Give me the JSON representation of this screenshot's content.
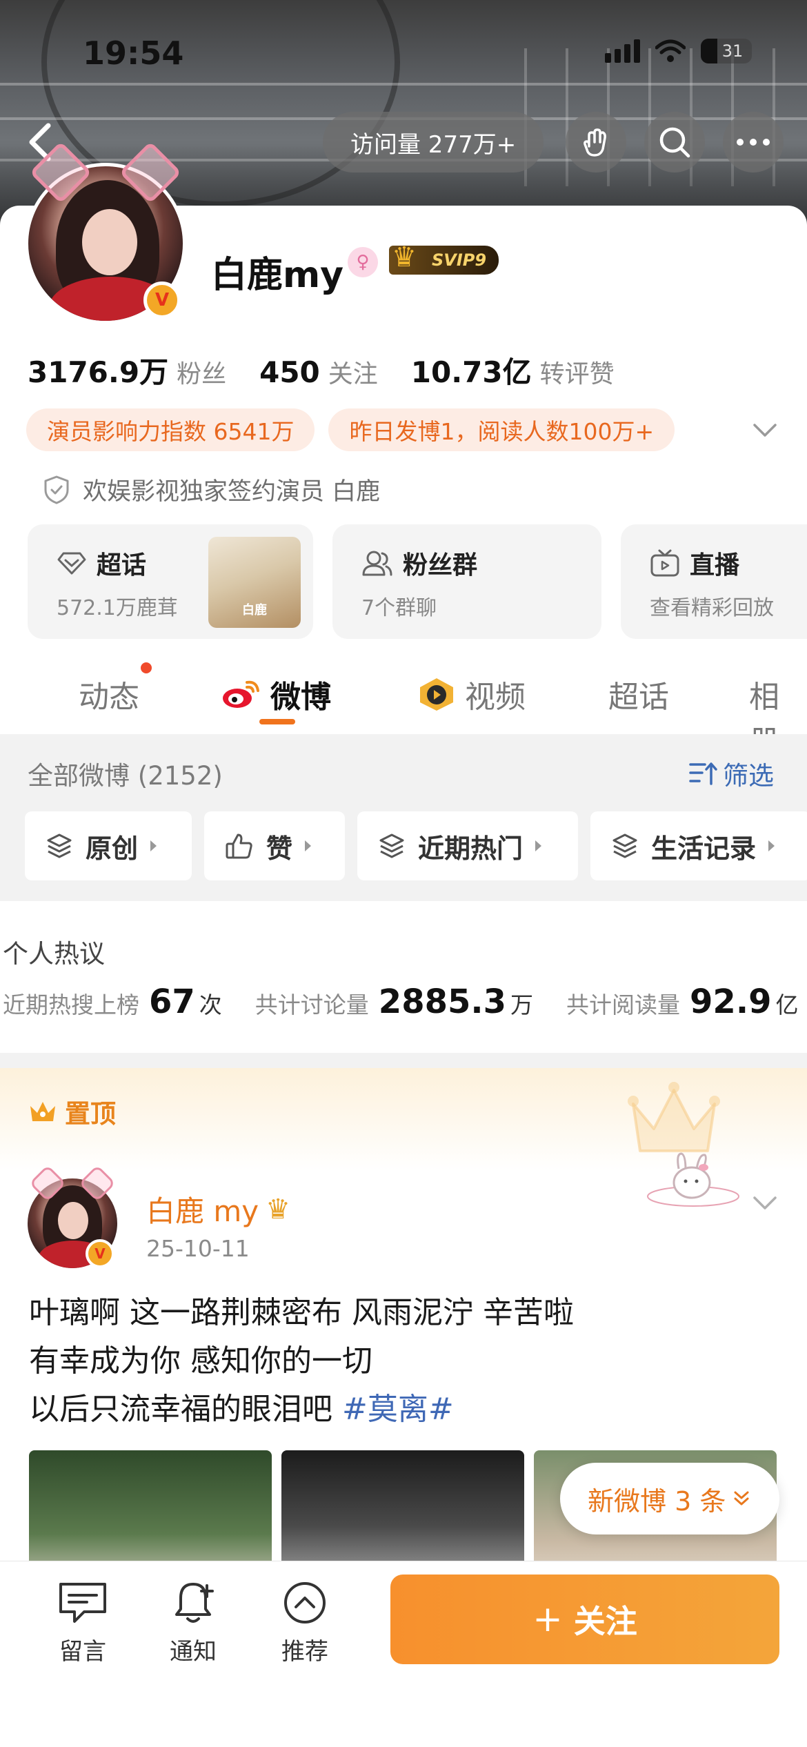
{
  "status_bar": {
    "time": "19:54",
    "battery": "31"
  },
  "header": {
    "visits": "访问量 277万+"
  },
  "profile": {
    "name": "白鹿my",
    "gender_symbol": "♀",
    "vip_badge": "SVIP9",
    "verified_mark": "V",
    "stats": [
      {
        "value": "3176.9万",
        "label": "粉丝"
      },
      {
        "value": "450",
        "label": "关注"
      },
      {
        "value": "10.73亿",
        "label": "转评赞"
      }
    ],
    "tags": [
      "演员影响力指数 6541万",
      "昨日发博1，阅读人数100万+"
    ],
    "signature": "欢娱影视独家签约演员 白鹿"
  },
  "feature_tiles": [
    {
      "title": "超话",
      "subtitle": "572.1万鹿茸",
      "thumb_text": "白鹿",
      "icon": "diamond-icon"
    },
    {
      "title": "粉丝群",
      "subtitle": "7个群聊",
      "icon": "group-icon"
    },
    {
      "title": "直播",
      "subtitle": "查看精彩回放",
      "icon": "tv-icon"
    }
  ],
  "tabs": [
    {
      "label": "动态",
      "active": false
    },
    {
      "label": "微博",
      "active": true
    },
    {
      "label": "视频",
      "active": false
    },
    {
      "label": "超话",
      "active": false
    },
    {
      "label": "相册",
      "active": false
    }
  ],
  "feed_filter": {
    "all_count": "全部微博 (2152)",
    "filter_label": "筛选",
    "chips": [
      "原创",
      "赞",
      "近期热门",
      "生活记录"
    ]
  },
  "personal_heat": {
    "title": "个人热议",
    "items": [
      {
        "label": "近期热搜上榜",
        "value": "67",
        "unit": "次"
      },
      {
        "label": "共计讨论量",
        "value": "2885.3",
        "unit": "万"
      },
      {
        "label": "共计阅读量",
        "value": "92.9",
        "unit": "亿"
      }
    ]
  },
  "pinned_post": {
    "pinned_label": "置顶",
    "author": "白鹿 my",
    "date": "25-10-11",
    "lines": [
      "叶璃啊 这一路荆棘密布 风雨泥泞 辛苦啦",
      "有幸成为你 感知你的一切"
    ],
    "line3_text": "以后只流幸福的眼泪吧 ",
    "hashtag": "#莫离#"
  },
  "new_posts_label": "新微博 3 条",
  "bottom_bar": {
    "items": [
      "留言",
      "通知",
      "推荐"
    ],
    "follow_label": "关注",
    "follow_plus": "+"
  },
  "colors": {
    "accent": "#F0731D",
    "link": "#3F68B5",
    "tag_bg": "#FDECE4"
  }
}
